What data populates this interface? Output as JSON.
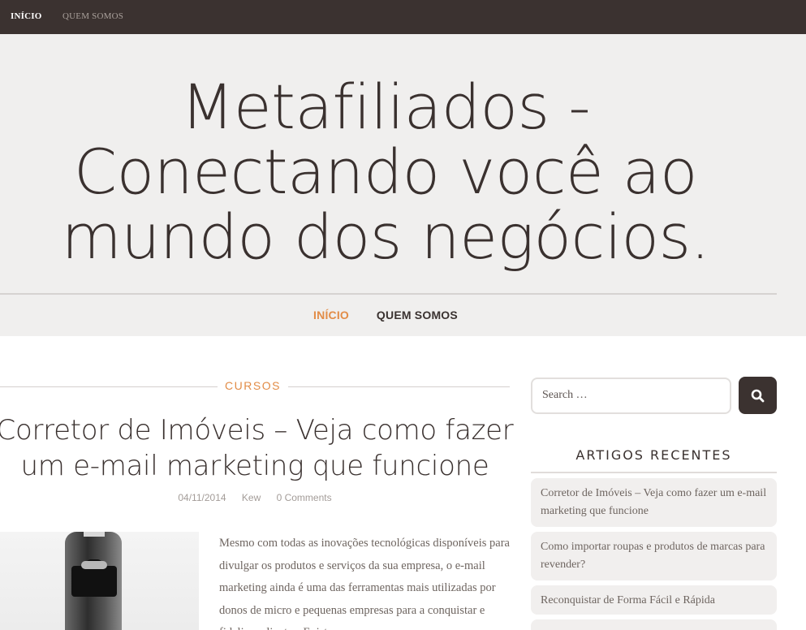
{
  "topbar": {
    "items": [
      "INÍCIO",
      "QUEM SOMOS"
    ]
  },
  "header": {
    "site_title": "Metafiliados - Conectando você ao mundo dos negócios.",
    "nav": [
      "INÍCIO",
      "QUEM SOMOS"
    ]
  },
  "post": {
    "category": "CURSOS",
    "title": "Corretor de Imóveis – Veja como fazer um e-mail marketing que funcione",
    "date": "04/11/2014",
    "author": "Kew",
    "comments": "0 Comments",
    "excerpt": "Mesmo com todas as inovações tecnológicas disponíveis para divulgar os produtos e serviços da sua empresa, o e-mail marketing ainda é uma das ferramentas mais utilizadas por donos de micro e pequenas empresas para a conquistar e fidelizar clientes. Existem"
  },
  "sidebar": {
    "search_placeholder": "Search …",
    "recent_title": "ARTIGOS RECENTES",
    "recent_posts": [
      "Corretor de Imóveis – Veja como fazer um e-mail marketing que funcione",
      "Como importar roupas e produtos de marcas para revender?",
      "Reconquistar de Forma Fácil e Rápida",
      ""
    ]
  },
  "colors": {
    "accent": "#e28c47",
    "dark": "#3b3230",
    "header_bg": "#f0efee"
  }
}
